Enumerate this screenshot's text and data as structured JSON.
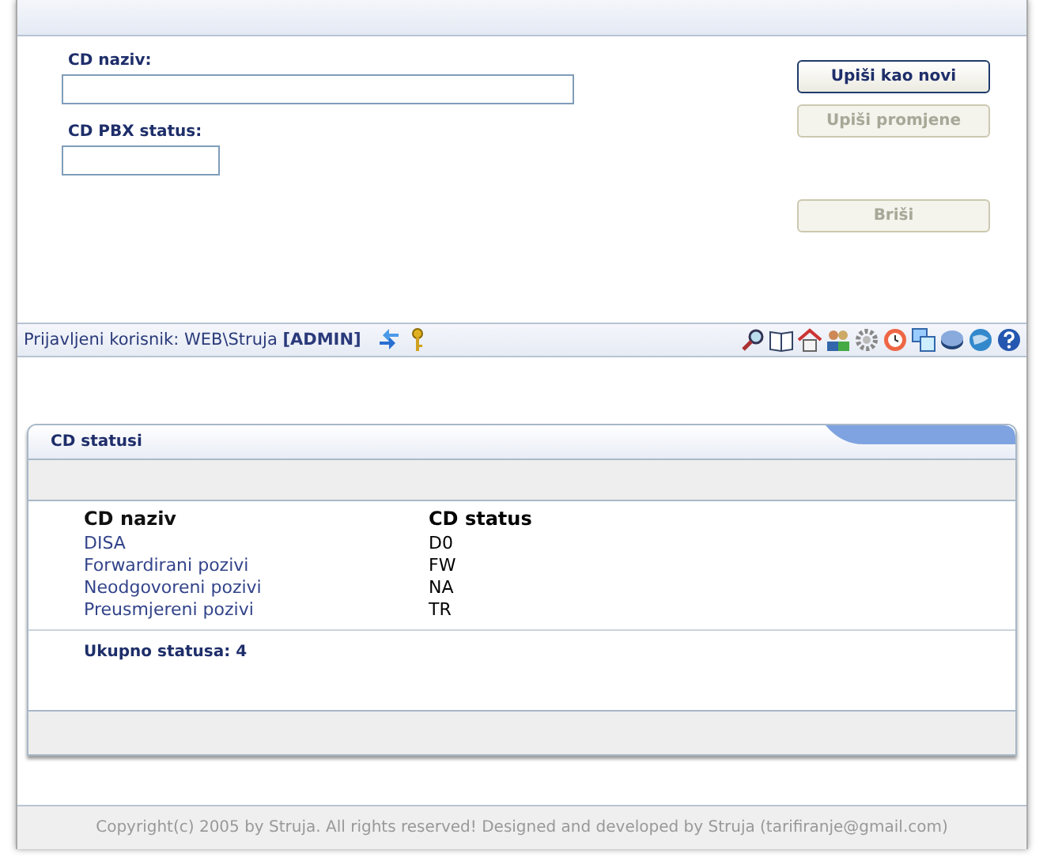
{
  "form": {
    "fields": [
      {
        "label": "CD naziv:",
        "kind": "wide"
      },
      {
        "label": "CD PBX status:",
        "kind": "narrow"
      }
    ],
    "buttons": [
      {
        "label": "Upiši kao novi",
        "disabled": false
      },
      {
        "label": "Upiši promjene",
        "disabled": true
      },
      {
        "label": "Briši",
        "disabled": true
      }
    ]
  },
  "status_bar": {
    "prefix": "Prijavljeni korisnik: WEB\\Struja",
    "role": "[ADMIN]"
  },
  "panel": {
    "title": "CD statusi",
    "columns": [
      "CD naziv",
      "CD status"
    ],
    "rows": [
      {
        "name": "DISA",
        "status": "D0"
      },
      {
        "name": "Forwardirani pozivi",
        "status": "FW"
      },
      {
        "name": "Neodgovoreni pozivi",
        "status": "NA"
      },
      {
        "name": "Preusmjereni pozivi",
        "status": "TR"
      }
    ],
    "total": "Ukupno statusa: 4"
  },
  "footer": "Copyright(c) 2005 by Struja. All rights reserved! Designed and developed by Struja (tarifiranje@gmail.com)"
}
